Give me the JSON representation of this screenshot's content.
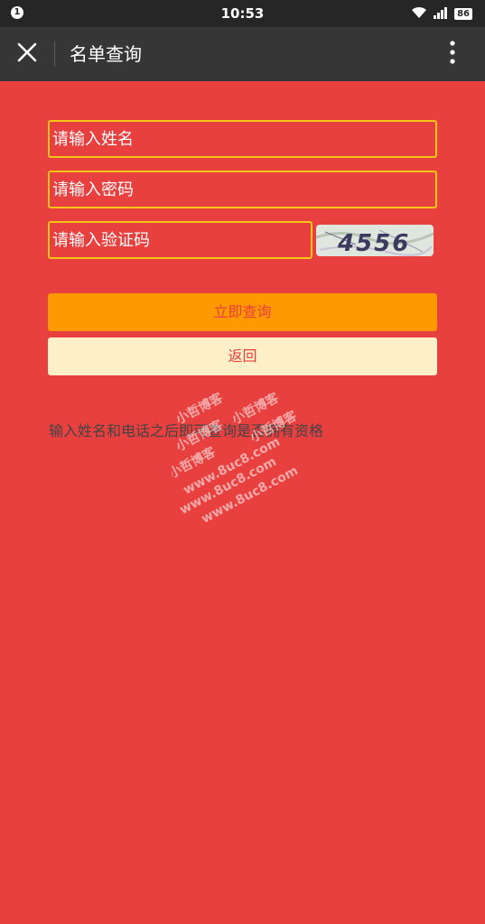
{
  "status_bar": {
    "notification_count": "1",
    "time": "10:53",
    "battery": "86"
  },
  "nav": {
    "title": "名单查询"
  },
  "form": {
    "name_placeholder": "请输入姓名",
    "password_placeholder": "请输入密码",
    "captcha_placeholder": "请输入验证码",
    "captcha_text": "4556",
    "query_button": "立即查询",
    "back_button": "返回"
  },
  "hint": "输入姓名和电话之后即可查询是否拥有资格",
  "watermark": {
    "line1": "小哲博客",
    "line2": "www.8uc8.com"
  },
  "colors": {
    "background": "#e83f3f",
    "nav_bar": "#363636",
    "status_bar": "#262626",
    "field_border": "#f5c518",
    "query_button": "#ff9900",
    "back_button": "#fdf0c8"
  }
}
